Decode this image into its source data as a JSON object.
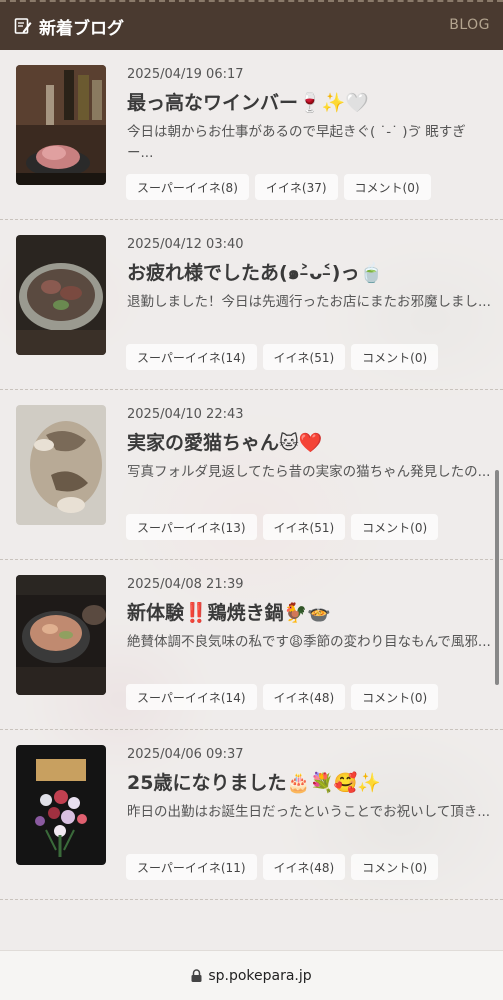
{
  "header": {
    "title": "新着ブログ",
    "blog_link": "BLOG",
    "icon": "memo-icon"
  },
  "posts": [
    {
      "date": "2025/04/19 06:17",
      "title": "最っ高なワインバー🍷✨🤍",
      "excerpt": "今日は朝からお仕事があるので早起きぐ( ˙-˙ )ゔ 眠すぎー...",
      "super_like": "スーパーイイネ(8)",
      "like": "イイネ(37)",
      "comment": "コメント(0)",
      "thumb": "wine-bar-photo"
    },
    {
      "date": "2025/04/12 03:40",
      "title": "お疲れ様でしたあ(๑˃̵ᴗ˂̵)っ🍵",
      "excerpt": "退勤しました！今日は先週行ったお店にまたお邪魔しまし...",
      "super_like": "スーパーイイネ(14)",
      "like": "イイネ(51)",
      "comment": "コメント(0)",
      "thumb": "grill-photo"
    },
    {
      "date": "2025/04/10 22:43",
      "title": "実家の愛猫ちゃん🐱❤️",
      "excerpt": "写真フォルダ見返してたら昔の実家の猫ちゃん発見したの...",
      "super_like": "スーパーイイネ(13)",
      "like": "イイネ(51)",
      "comment": "コメント(0)",
      "thumb": "cat-photo"
    },
    {
      "date": "2025/04/08 21:39",
      "title": "新体験‼️鶏焼き鍋🐓🍲",
      "excerpt": "絶賛体調不良気味の私です😩季節の変わり目なもんで風邪...",
      "super_like": "スーパーイイネ(14)",
      "like": "イイネ(48)",
      "comment": "コメント(0)",
      "thumb": "chicken-hotpot-photo"
    },
    {
      "date": "2025/04/06 09:37",
      "title": "25歳になりました🎂💐🥰✨",
      "excerpt": "昨日の出勤はお誕生日だったということでお祝いして頂き...",
      "super_like": "スーパーイイネ(11)",
      "like": "イイネ(48)",
      "comment": "コメント(0)",
      "thumb": "birthday-flowers-photo"
    }
  ],
  "browser": {
    "url": "sp.pokepara.jp",
    "icon": "lock-icon"
  }
}
